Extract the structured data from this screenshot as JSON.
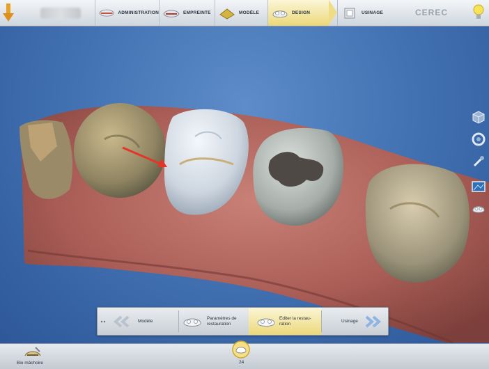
{
  "phases": [
    {
      "label": "ADMINISTRATION",
      "icon": "administration-icon"
    },
    {
      "label": "EMPREINTE",
      "icon": "impression-icon"
    },
    {
      "label": "MODÈLE",
      "icon": "model-icon"
    },
    {
      "label": "DESIGN",
      "icon": "design-icon",
      "active": true
    },
    {
      "label": "USINAGE",
      "icon": "milling-icon"
    }
  ],
  "brand": "CEREC",
  "workflow": {
    "steps": [
      {
        "label": "Modèle"
      },
      {
        "label_line1": "Paramètres de",
        "label_line2": "restauration"
      },
      {
        "label_line1": "Editer la restau-",
        "label_line2": "ration",
        "current": true
      },
      {
        "label": "Usinage"
      }
    ]
  },
  "status": {
    "bio_label": "Bio mâchoire",
    "selected_tooth": "24"
  },
  "colors": {
    "accent_active": "#ecd87a",
    "viewport_blue": "#4474b4",
    "gum": "#b86a62",
    "restoration": "#dfe7ef",
    "arrow": "#e4352a"
  }
}
